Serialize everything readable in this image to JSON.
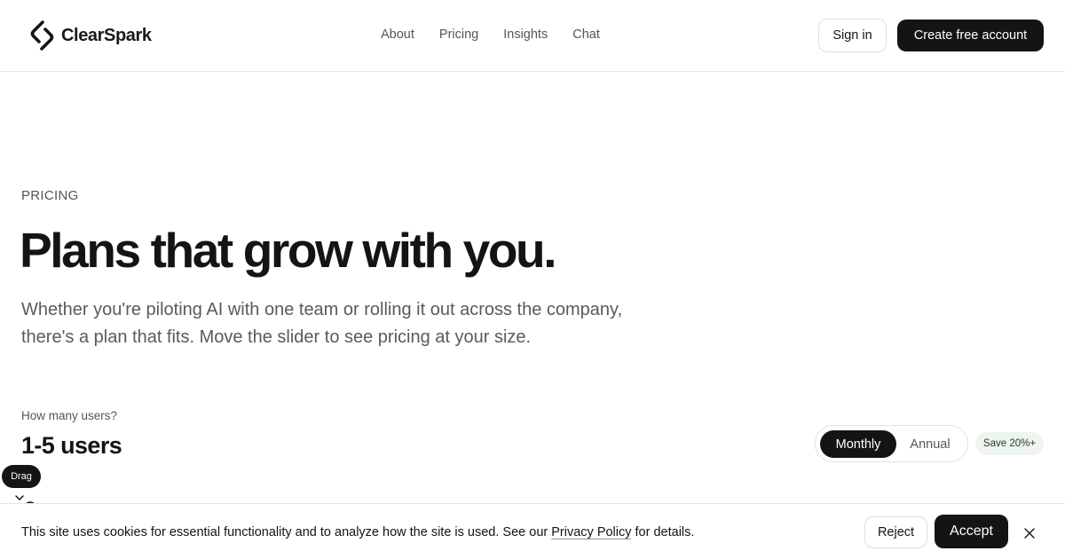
{
  "header": {
    "brand": "ClearSpark",
    "nav": [
      "About",
      "Pricing",
      "Insights",
      "Chat"
    ],
    "sign_in": "Sign in",
    "create_account": "Create free account"
  },
  "hero": {
    "eyebrow": "PRICING",
    "headline": "Plans that grow with you.",
    "lede": "Whether you're piloting AI with one team or rolling it out across the company, there's a plan that fits. Move the slider to see pricing at your size."
  },
  "users": {
    "label": "How many users?",
    "value": "1-5 users",
    "drag_tip": "Drag"
  },
  "billing": {
    "monthly": "Monthly",
    "annual": "Annual",
    "selected": "Monthly",
    "save_badge": "Save 20%+"
  },
  "cookie": {
    "text_before": "This site uses cookies for essential functionality and to analyze how the site is used. See our ",
    "link": "Privacy Policy",
    "text_after": " for details.",
    "reject": "Reject",
    "accept": "Accept"
  },
  "colors": {
    "primary": "#141414",
    "muted": "#555555",
    "badge_bg": "#eef4ee",
    "border": "#e8e8e8"
  },
  "icons": {
    "logo": "spark-logo-icon",
    "slider": "slider-handle-icon",
    "close": "close-icon"
  }
}
